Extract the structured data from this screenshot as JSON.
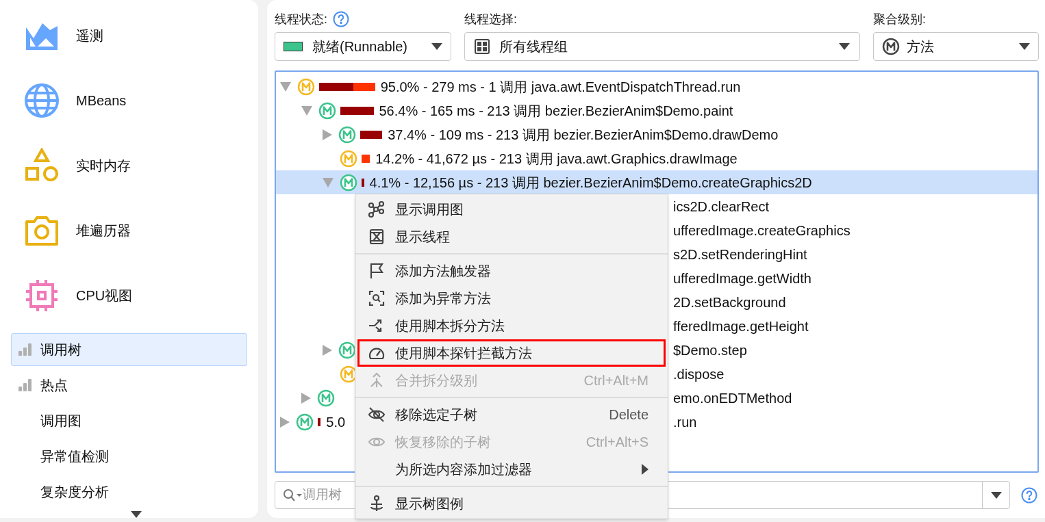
{
  "sidebar": {
    "views": [
      {
        "label": "遥测",
        "kind": "telemetry"
      },
      {
        "label": "MBeans",
        "kind": "globe"
      },
      {
        "label": "实时内存",
        "kind": "shapes"
      },
      {
        "label": "堆遍历器",
        "kind": "camera"
      },
      {
        "label": "CPU视图",
        "kind": "chip"
      }
    ],
    "items": [
      {
        "label": "调用树",
        "selected": true,
        "kind": "bars"
      },
      {
        "label": "热点",
        "selected": false,
        "kind": "bars"
      },
      {
        "label": "调用图",
        "selected": false,
        "kind": "plain"
      },
      {
        "label": "异常值检测",
        "selected": false,
        "kind": "plain"
      },
      {
        "label": "复杂度分析",
        "selected": false,
        "kind": "plain"
      }
    ]
  },
  "filters": {
    "thread_state": {
      "label": "线程状态:",
      "value": "就绪(Runnable)",
      "color": "#3cc48c"
    },
    "thread_selection": {
      "label": "线程选择:",
      "value": "所有线程组"
    },
    "aggregation": {
      "label": "聚合级别:",
      "value": "方法"
    }
  },
  "tree": [
    {
      "expandable": true,
      "expanded": true,
      "color": "#f5b820",
      "bar": [
        {
          "color": "#990000"
        },
        {
          "color": "#ff3300"
        }
      ],
      "head": "95.0% - 279 ms - 1 调用 java.awt.EventDispatchThread.run",
      "selected": false,
      "children": [
        {
          "expandable": true,
          "expanded": true,
          "color": "#3cc48c",
          "bar": [
            {
              "color": "#990000"
            }
          ],
          "head": "56.4% - 165 ms - 213 调用 bezier.BezierAnim$Demo.paint",
          "selected": false,
          "children": [
            {
              "expandable": true,
              "expanded": false,
              "color": "#3cc48c",
              "bar": [
                {
                  "color": "#990000"
                }
              ],
              "head": "37.4% - 109 ms - 213 调用 bezier.BezierAnim$Demo.drawDemo",
              "selected": false
            },
            {
              "expandable": false,
              "color": "#f5b820",
              "bar": [
                {
                  "color": "#ff3300"
                }
              ],
              "head": "14.2% - 41,672 µs - 213 调用 java.awt.Graphics.drawImage",
              "selected": false
            },
            {
              "expandable": true,
              "expanded": true,
              "color": "#3cc48c",
              "bar": [
                {
                  "color": "#990000"
                }
              ],
              "head": "4.1% - 12,156 µs - 213 调用 bezier.BezierAnim$Demo.createGraphics2D",
              "selected": true,
              "children": [
                {
                  "tail": "ics2D.clearRect",
                  "selected": false
                },
                {
                  "tail": "ufferedImage.createGraphics",
                  "selected": false
                },
                {
                  "tail": "s2D.setRenderingHint",
                  "selected": false
                },
                {
                  "tail": "ufferedImage.getWidth",
                  "selected": false
                },
                {
                  "tail": "2D.setBackground",
                  "selected": false
                },
                {
                  "tail": "fferedImage.getHeight",
                  "selected": false
                }
              ]
            },
            {
              "expandable": true,
              "expanded": false,
              "color": "#3cc48c",
              "tail": "$Demo.step",
              "selected": false
            },
            {
              "expandable": false,
              "color": "#f5b820",
              "tail": ".dispose",
              "selected": false
            }
          ]
        },
        {
          "expandable": true,
          "expanded": false,
          "color": "#3cc48c",
          "tail": "emo.onEDTMethod",
          "selected": false
        }
      ]
    },
    {
      "expandable": true,
      "expanded": false,
      "color": "#3cc48c",
      "bar": [
        {
          "color": "#990000"
        }
      ],
      "head": "5.0",
      "tail": ".run",
      "selected": false
    }
  ],
  "search": {
    "placeholder": "调用树"
  },
  "context_menu": [
    {
      "kind": "item",
      "label": "显示调用图",
      "disabled": false,
      "highlighted": false
    },
    {
      "kind": "item",
      "label": "显示线程",
      "disabled": false,
      "highlighted": false
    },
    {
      "kind": "separator"
    },
    {
      "kind": "item",
      "label": "添加方法触发器",
      "disabled": false,
      "highlighted": false
    },
    {
      "kind": "item",
      "label": "添加为异常方法",
      "disabled": false,
      "highlighted": false
    },
    {
      "kind": "item",
      "label": "使用脚本拆分方法",
      "disabled": false,
      "highlighted": false
    },
    {
      "kind": "item",
      "label": "使用脚本探针拦截方法",
      "disabled": false,
      "highlighted": true
    },
    {
      "kind": "item",
      "label": "合并拆分级别",
      "shortcut": "Ctrl+Alt+M",
      "disabled": true,
      "highlighted": false
    },
    {
      "kind": "separator"
    },
    {
      "kind": "item",
      "label": "移除选定子树",
      "shortcut": "Delete",
      "disabled": false,
      "highlighted": false
    },
    {
      "kind": "item",
      "label": "恢复移除的子树",
      "shortcut": "Ctrl+Alt+S",
      "disabled": true,
      "highlighted": false
    },
    {
      "kind": "submenu",
      "label": "为所选内容添加过滤器",
      "disabled": false,
      "highlighted": false
    },
    {
      "kind": "separator"
    },
    {
      "kind": "item",
      "label": "显示树图例",
      "disabled": false,
      "highlighted": false
    }
  ]
}
